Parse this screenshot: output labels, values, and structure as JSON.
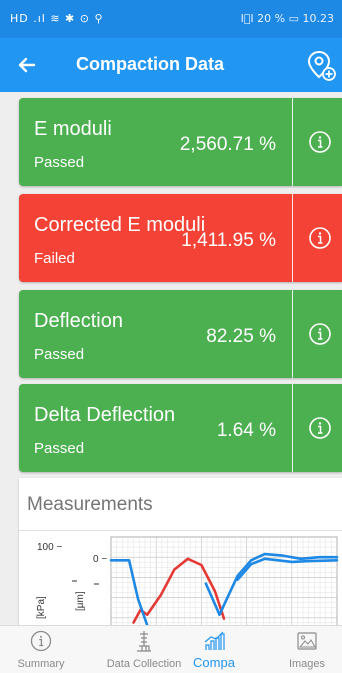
{
  "status_bar": {
    "left_text": "HD .ıl ≋ ✱ ⊙ ⚲",
    "right_text": "I⃞I 20 % ▭ 10.23"
  },
  "app_bar": {
    "title": "Compaction Data",
    "back_icon": "arrow-left-icon",
    "action_icon": "location-pin-add-icon"
  },
  "cards": [
    {
      "title": "E moduli",
      "status": "Passed",
      "value": "2,560.71 %",
      "state": "passed"
    },
    {
      "title": "Corrected E moduli",
      "status": "Failed",
      "value": "1,411.95 %",
      "state": "failed"
    },
    {
      "title": "Deflection",
      "status": "Passed",
      "value": "82.25 %",
      "state": "passed"
    },
    {
      "title": "Delta Deflection",
      "status": "Passed",
      "value": "1.64 %",
      "state": "passed"
    }
  ],
  "colors": {
    "primary": "#2196f3",
    "status_bar": "#1e88e5",
    "passed": "#4caf50",
    "failed": "#f44336",
    "chart_blue": "#1e88e5",
    "chart_red": "#e53935"
  },
  "measurements": {
    "title": "Measurements",
    "y_tick_left": "100 −",
    "y_tick_right": "0 −",
    "ylabel_left": "[kPa]",
    "ylabel_right": "[µm]"
  },
  "chart_data": {
    "type": "line",
    "title": "",
    "xlabel": "",
    "ylabel": "",
    "grid": true,
    "legend": "none",
    "axes": [
      {
        "side": "left",
        "unit_label": "[kPa]",
        "visible_ticks": [
          "100"
        ]
      },
      {
        "side": "right",
        "unit_label": "[µm]",
        "visible_ticks": [
          "0"
        ]
      }
    ],
    "x_range": [
      0,
      100
    ],
    "y_range": [
      -100,
      30
    ],
    "series": [
      {
        "color": "#e53935",
        "points": [
          [
            10,
            -80
          ],
          [
            13,
            -64
          ],
          [
            16,
            -70
          ],
          [
            22,
            -45
          ],
          [
            28,
            -12
          ],
          [
            34,
            2
          ],
          [
            40,
            -6
          ],
          [
            46,
            -40
          ],
          [
            50,
            -75
          ]
        ]
      },
      {
        "color": "#1e88e5",
        "points": [
          [
            0,
            0
          ],
          [
            8,
            0
          ],
          [
            12,
            -50
          ],
          [
            18,
            -100
          ]
        ]
      },
      {
        "color": "#1e88e5",
        "points": [
          [
            42,
            -30
          ],
          [
            48,
            -70
          ],
          [
            52,
            -45
          ],
          [
            56,
            -20
          ],
          [
            62,
            0
          ],
          [
            68,
            8
          ],
          [
            76,
            6
          ],
          [
            84,
            2
          ],
          [
            92,
            4
          ],
          [
            100,
            4
          ]
        ]
      },
      {
        "color": "#1e88e5",
        "points": [
          [
            56,
            -25
          ],
          [
            62,
            -5
          ],
          [
            68,
            2
          ],
          [
            74,
            0
          ],
          [
            80,
            -2
          ],
          [
            88,
            -1
          ],
          [
            100,
            0
          ]
        ]
      }
    ]
  },
  "bottom_nav": [
    {
      "label": "Summary",
      "icon": "info-circle-icon",
      "active": false
    },
    {
      "label": "Data Collection",
      "icon": "drill-rig-icon",
      "active": false
    },
    {
      "label": "Compa",
      "icon": "bar-chart-icon",
      "active": true
    },
    {
      "label": "Images",
      "icon": "image-icon",
      "active": false
    }
  ]
}
